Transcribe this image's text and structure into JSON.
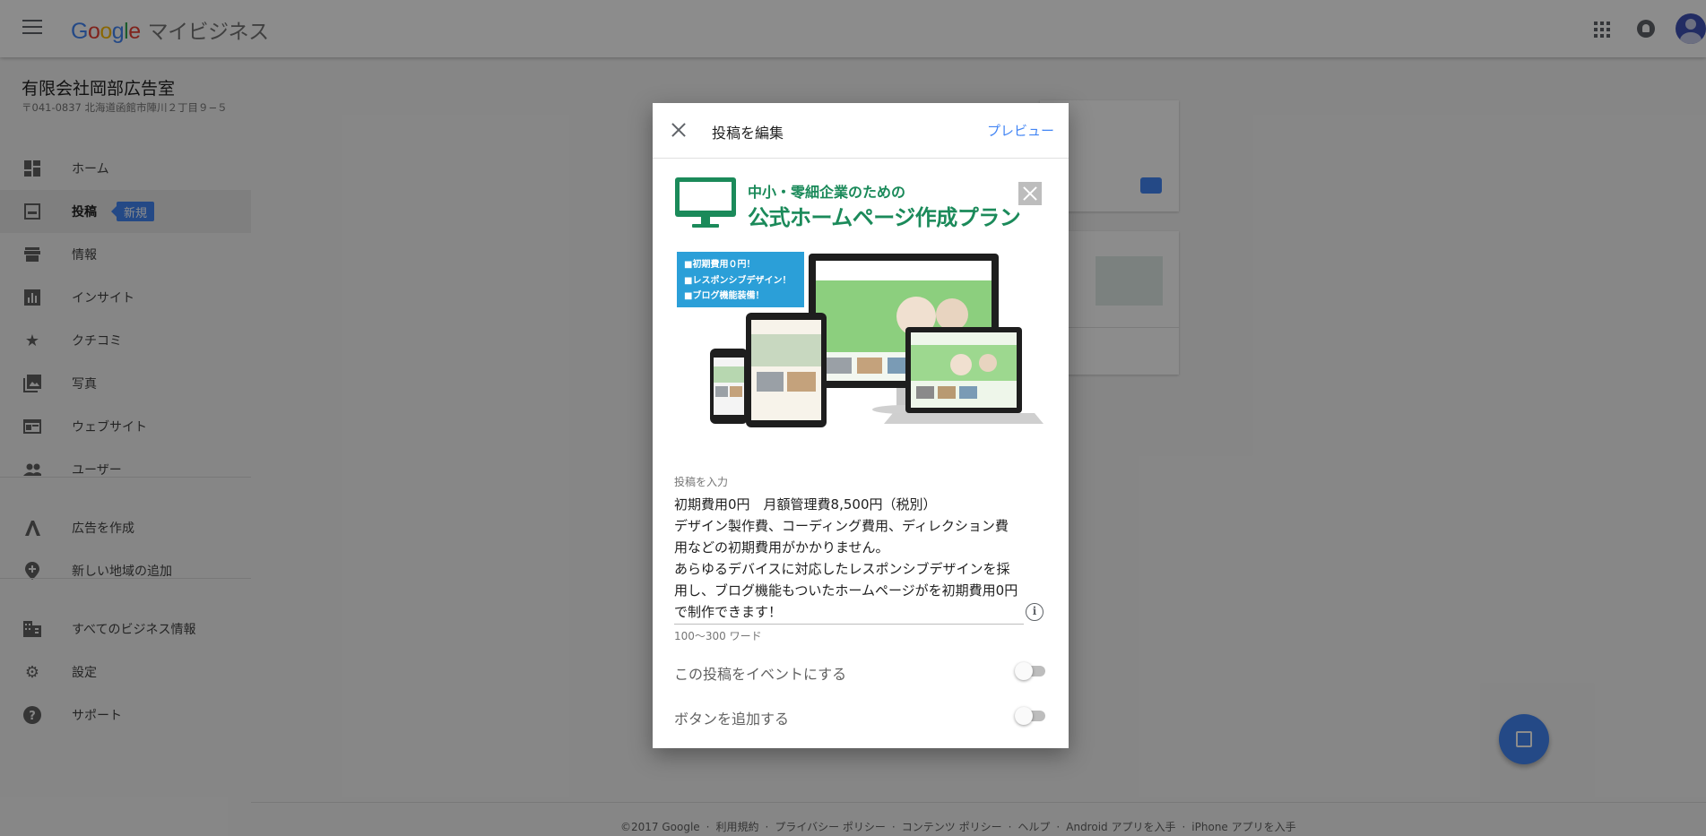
{
  "header": {
    "logo_google": [
      "G",
      "o",
      "o",
      "g",
      "l",
      "e"
    ],
    "product_name": "マイビジネス"
  },
  "business": {
    "name": "有限会社岡部広告室",
    "address": "〒041-0837 北海道函館市陣川２丁目９−５"
  },
  "sidebar": {
    "items": [
      {
        "label": "ホーム",
        "icon": "dashboard-icon"
      },
      {
        "label": "投稿",
        "icon": "post-icon",
        "badge": "新規",
        "active": true
      },
      {
        "label": "情報",
        "icon": "store-icon"
      },
      {
        "label": "インサイト",
        "icon": "insights-icon"
      },
      {
        "label": "クチコミ",
        "icon": "star-icon"
      },
      {
        "label": "写真",
        "icon": "photos-icon"
      },
      {
        "label": "ウェブサイト",
        "icon": "website-icon"
      },
      {
        "label": "ユーザー",
        "icon": "people-icon"
      },
      {
        "label": "広告を作成",
        "icon": "adwords-icon"
      },
      {
        "label": "新しい地域の追加",
        "icon": "add-location-icon"
      },
      {
        "label": "すべてのビジネス情報",
        "icon": "building-icon"
      },
      {
        "label": "設定",
        "icon": "gear-icon"
      },
      {
        "label": "サポート",
        "icon": "help-icon"
      }
    ]
  },
  "dialog": {
    "title": "投稿を編集",
    "preview": "プレビュー",
    "banner": {
      "line1": "中小・零細企業のための",
      "line2": "公式ホームページ作成プラン",
      "features": [
        "■初期費用０円！",
        "■レスポンシブデザイン！",
        "■ブログ機能装備！"
      ]
    },
    "field_label": "投稿を入力",
    "post_text": "初期費用0円　月額管理費8,500円（税別）\nデザイン製作費、コーディング費用、ディレクション費用などの初期費用がかかりません。\nあらゆるデバイスに対応したレスポンシブデザインを採用し、ブログ機能もついたホームページがを初期費用0円で制作できます！",
    "word_hint": "100〜300 ワード",
    "toggle_event": "この投稿をイベントにする",
    "toggle_button": "ボタンを追加する",
    "toggle_event_on": false,
    "toggle_button_on": false
  },
  "footer": {
    "links": [
      "©2017 Google",
      "利用規約",
      "プライバシー ポリシー",
      "コンテンツ ポリシー",
      "ヘルプ",
      "Android アプリを入手",
      "iPhone アプリを入手"
    ]
  },
  "colors": {
    "accent": "#4285f4",
    "banner_green": "#1b8a5a",
    "feature_blue": "#2b9fd8"
  }
}
